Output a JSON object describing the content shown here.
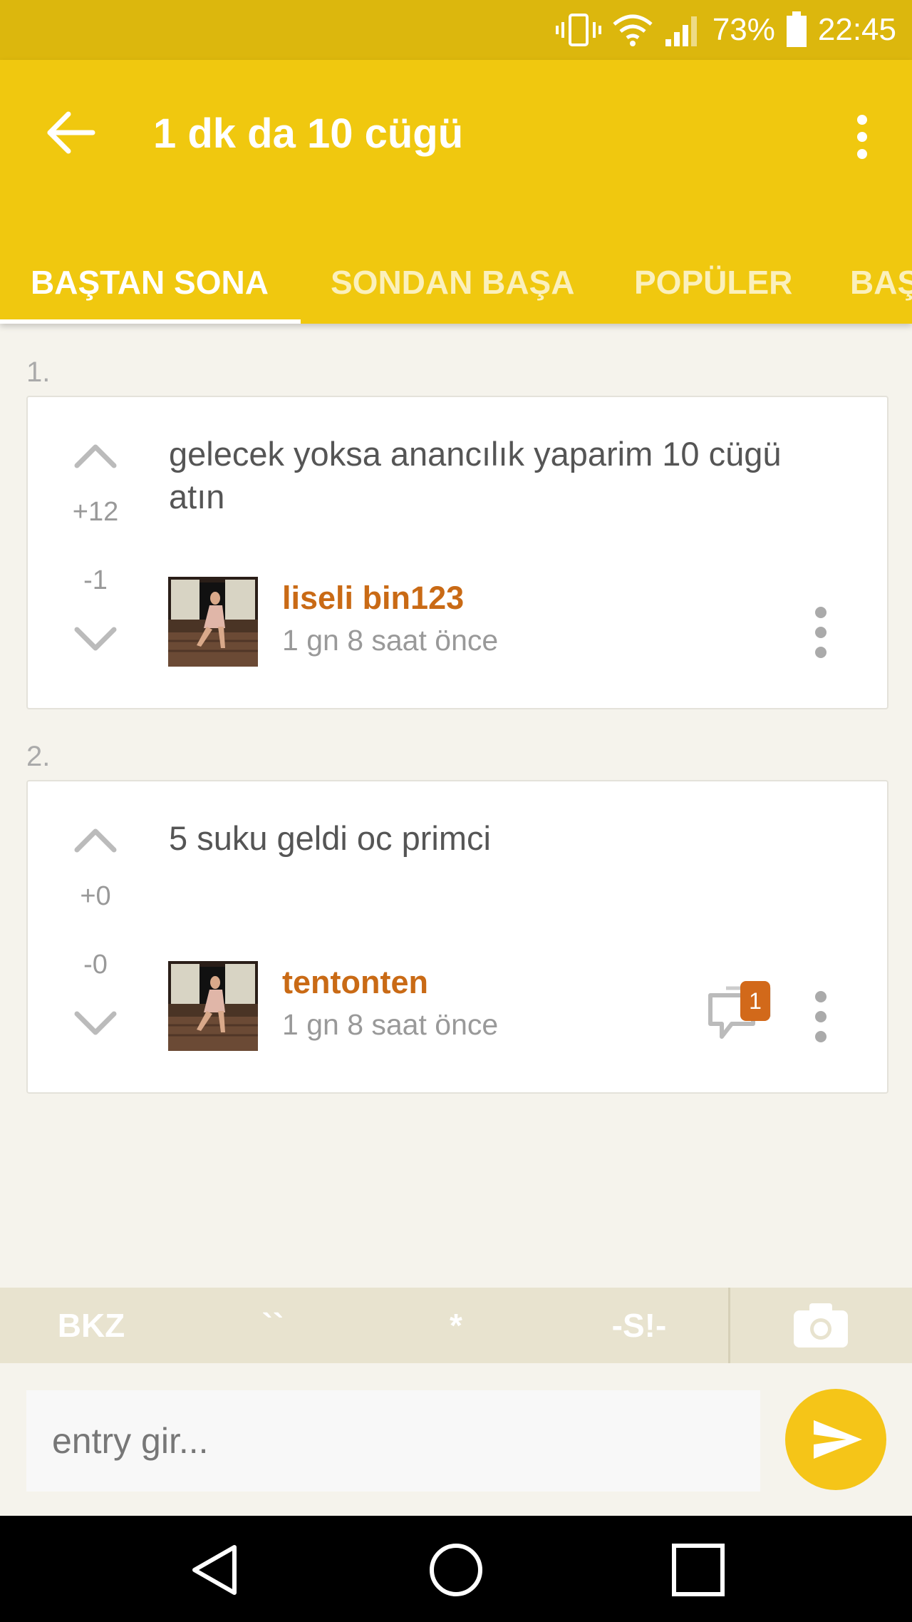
{
  "status_bar": {
    "battery": "73%",
    "time": "22:45"
  },
  "app_bar": {
    "title": "1 dk da 10 cügü"
  },
  "tabs": [
    {
      "label": "BAŞTAN SONA",
      "active": true
    },
    {
      "label": "SONDAN BAŞA",
      "active": false
    },
    {
      "label": "POPÜLER",
      "active": false
    },
    {
      "label": "BAŞ",
      "active": false
    }
  ],
  "entries": [
    {
      "number": "1.",
      "text": "gelecek yoksa anancılık yaparim 10 cügü atın",
      "upvotes": "+12",
      "downvotes": "-1",
      "author": "liseli bin123",
      "time": "1 gn 8 saat  önce",
      "comment_count": ""
    },
    {
      "number": "2.",
      "text": "5 suku geldi oc primci",
      "upvotes": "+0",
      "downvotes": "-0",
      "author": "tentonten",
      "time": "1 gn 8 saat  önce",
      "comment_count": "1"
    }
  ],
  "toolbar": {
    "bkz": "BKZ",
    "backtick": "``",
    "asterisk": "*",
    "spoiler": "-S!-"
  },
  "compose": {
    "placeholder": "entry gir..."
  },
  "colors": {
    "status_bar": "#dcb70d",
    "app_bar": "#f0c80f",
    "author": "#c96a15",
    "badge": "#d2691a",
    "send": "#f5c518"
  }
}
